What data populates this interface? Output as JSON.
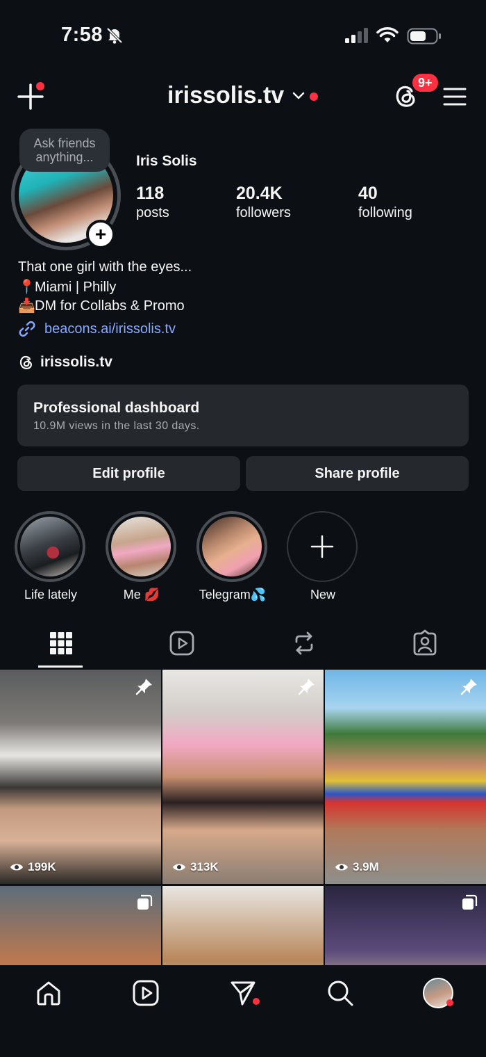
{
  "status_bar": {
    "time": "7:58"
  },
  "header": {
    "username": "irissolis.tv",
    "notification_badge": "9+"
  },
  "profile": {
    "note": "Ask friends anything...",
    "name": "Iris Solis",
    "stats": [
      {
        "value": "118",
        "label": "posts"
      },
      {
        "value": "20.4K",
        "label": "followers"
      },
      {
        "value": "40",
        "label": "following"
      }
    ],
    "bio": [
      {
        "icon": "",
        "text": "That one girl with the eyes..."
      },
      {
        "icon": "📍",
        "text": "Miami | Philly"
      },
      {
        "icon": "📥",
        "text": "DM for Collabs & Promo"
      }
    ],
    "link": "beacons.ai/irissolis.tv",
    "threads_handle": "irissolis.tv"
  },
  "dashboard": {
    "title": "Professional dashboard",
    "subtitle": "10.9M views in the last 30 days."
  },
  "buttons": {
    "edit": "Edit profile",
    "share": "Share profile"
  },
  "highlights": [
    {
      "label": "Life lately"
    },
    {
      "label": "Me 💋"
    },
    {
      "label": "Telegram💦"
    },
    {
      "label": "New"
    }
  ],
  "posts": [
    {
      "views": "199K",
      "pinned": true
    },
    {
      "views": "313K",
      "pinned": true
    },
    {
      "views": "3.9M",
      "pinned": true
    },
    {
      "views": "",
      "type": "carousel"
    },
    {
      "views": "",
      "type": "photo"
    },
    {
      "views": "",
      "type": "carousel"
    }
  ],
  "colors": {
    "background": "#0c1014",
    "surface": "#25292e",
    "accent_red": "#ff3040",
    "link_blue": "#86a8ff"
  }
}
